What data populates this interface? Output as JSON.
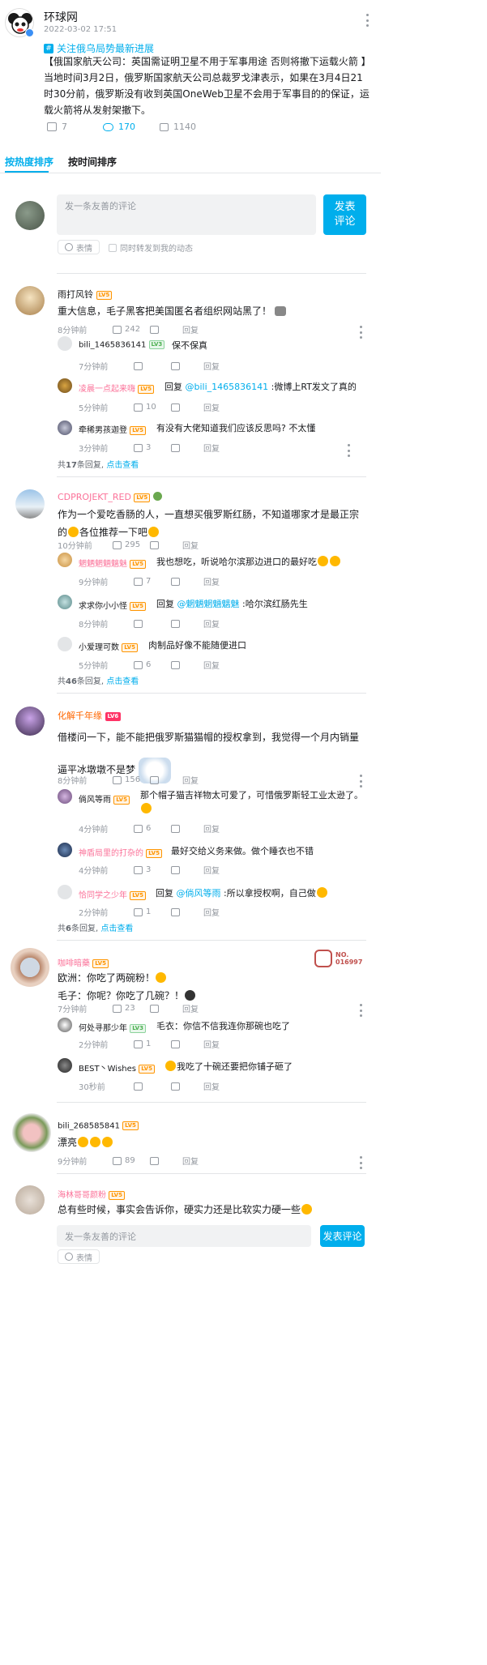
{
  "post": {
    "author": "环球网",
    "time": "2022-03-02 17:51",
    "topic": "关注俄乌局势最新进展",
    "title": "【俄国家航天公司：英国需证明卫星不用于军事用途 否则将撤下运载火箭 】",
    "body": "当地时间3月2日，俄罗斯国家航天公司总裁罗戈津表示，如果在3月4日21时30分前，俄罗斯没有收到英国OneWeb卫星不会用于军事目的的保证，运载火箭将从发射架撤下。",
    "shares": "7",
    "comments": "170",
    "likes": "1140"
  },
  "tabs": {
    "hot": "按热度排序",
    "time": "按时间排序"
  },
  "composer": {
    "placeholder": "发一条友善的评论",
    "submit": "发表\n评论",
    "emoji": "表情",
    "repost": "同时转发到我的动态"
  },
  "reply_label": "回复",
  "comments": [
    {
      "user": "雨打风铃",
      "level": "LV5",
      "text": "重大信息，毛子黑客把美国匿名者组织网站黑了！",
      "time": "8分钟前",
      "likes": "242",
      "replies": [
        {
          "user": "bili_1465836141",
          "level": "LV3",
          "text": "保不保真",
          "time": "7分钟前",
          "likes": ""
        },
        {
          "user": "凌晨一点起来嗨",
          "level": "LV5",
          "prefix": "回复",
          "mention": "@bili_1465836141",
          "text": ":微博上RT发文了真的",
          "time": "5分钟前",
          "likes": "10"
        },
        {
          "user": "牵稀男孩迦登",
          "level": "LV5",
          "text": "有没有大佬知道我们应该反思吗? 不太懂",
          "time": "3分钟前",
          "likes": "3"
        }
      ],
      "total_pre": "共",
      "total": "17",
      "total_post": "条回复,",
      "view_more": "点击查看"
    },
    {
      "user": "CDPROJEKT_RED",
      "level": "LV5",
      "text": "作为一个爱吃香肠的人，一直想买俄罗斯红肠，不知道哪家才是最正宗的",
      "text2": "各位推荐一下吧",
      "time": "10分钟前",
      "likes": "295",
      "replies": [
        {
          "user": "魍魉魍魎魑魅",
          "level": "LV5",
          "text": "我也想吃，听说哈尔滨那边进口的最好吃",
          "time": "9分钟前",
          "likes": "7"
        },
        {
          "user": "求求你小小怪",
          "level": "LV5",
          "prefix": "回复",
          "mention": "@魍魉魍魎魑魅",
          "text": ":哈尔滨红肠先生",
          "time": "8分钟前",
          "likes": ""
        },
        {
          "user": "小爱理可数",
          "level": "LV5",
          "text": "肉制品好像不能随便进口",
          "time": "5分钟前",
          "likes": "6"
        }
      ],
      "total_pre": "共",
      "total": "46",
      "total_post": "条回复,",
      "view_more": "点击查看"
    },
    {
      "user": "化解千年缘",
      "level": "LV6",
      "text": "借楼问一下，能不能把俄罗斯猫猫帽的授权拿到，我觉得一个月内销量逼平冰墩",
      "text2": "墩不是梦",
      "time": "8分钟前",
      "likes": "156",
      "replies": [
        {
          "user": "倘风等雨",
          "level": "LV5",
          "text": "那个帽子猫吉祥物太可爱了，可惜俄罗斯轻工业太逊了。",
          "time": "4分钟前",
          "likes": "6"
        },
        {
          "user": "神盾局里的打杂的",
          "level": "LV5",
          "text": "最好交给义务来做。做个睡衣也不错",
          "time": "4分钟前",
          "likes": "3"
        },
        {
          "user": "恰同学之少年",
          "level": "LV5",
          "prefix": "回复",
          "mention": "@倘风等雨",
          "text": ":所以拿授权啊，自己做",
          "time": "2分钟前",
          "likes": "1"
        }
      ],
      "total_pre": "共",
      "total": "6",
      "total_post": "条回复,",
      "view_more": "点击查看"
    },
    {
      "user": "咖啡暗藥",
      "level": "LV5",
      "badge": "NO.\n016997",
      "text": "欧洲：你吃了两碗粉！",
      "text2": "毛子：你呢？你吃了几碗？！",
      "time": "7分钟前",
      "likes": "23",
      "replies": [
        {
          "user": "何处寻那少年",
          "level": "LV3",
          "text": "毛衣：你信不信我连你那碗也吃了",
          "time": "2分钟前",
          "likes": "1"
        },
        {
          "user": "BEST丶Wishes",
          "level": "LV5",
          "text": "我吃了十碗还要把你铺子砸了",
          "time": "30秒前",
          "likes": ""
        }
      ]
    },
    {
      "user": "bili_268585841",
      "level": "LV5",
      "text": "漂亮",
      "time": "9分钟前",
      "likes": "89"
    },
    {
      "user": "海林哥哥颜粉",
      "level": "LV5",
      "text": "总有些时候，事实会告诉你，硬实力还是比软实力硬一些"
    }
  ],
  "bottom_composer": {
    "placeholder": "发一条友善的评论",
    "submit": "发表评论",
    "emoji": "表情"
  },
  "colors": {
    "accent": "#00aeec",
    "pink_name": "#fb7299",
    "level": "#ff9500"
  }
}
